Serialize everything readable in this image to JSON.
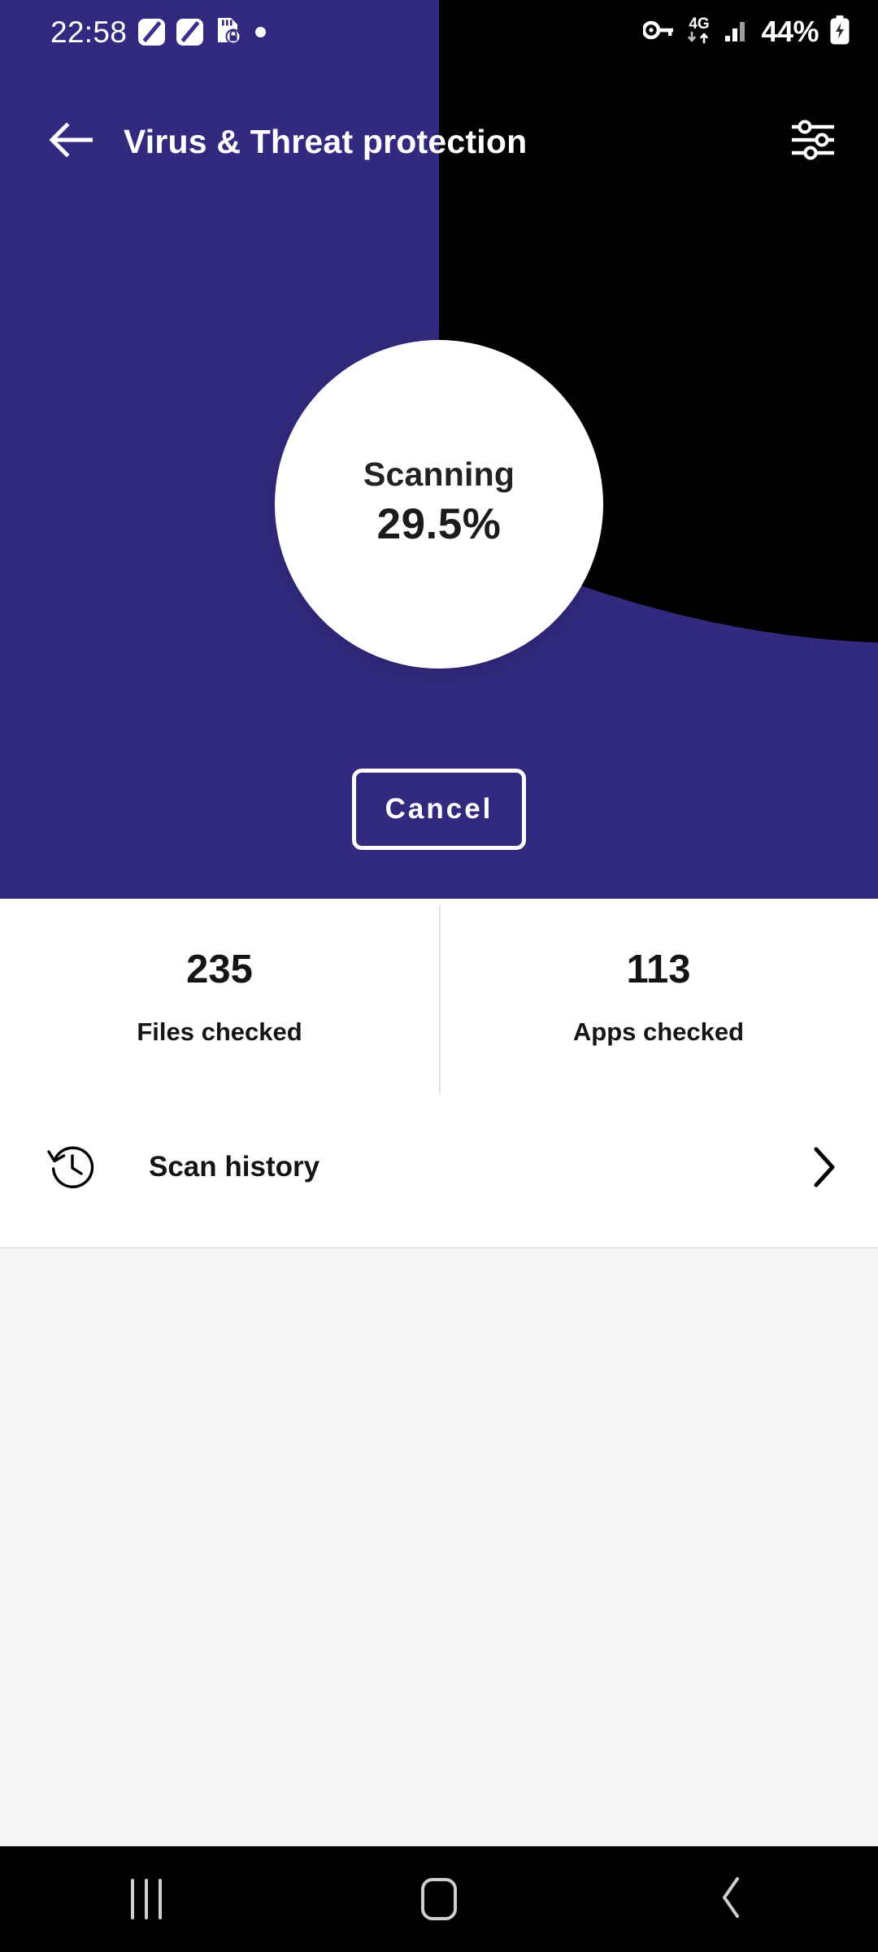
{
  "statusbar": {
    "time": "22:58",
    "battery_percent": "44%",
    "network_label": "4G",
    "icons": [
      "pen-icon",
      "pen-icon",
      "sd-card-lock-icon",
      "dot-icon",
      "vpn-key-icon",
      "mobile-data-4g-icon",
      "signal-bars-icon",
      "battery-charging-icon"
    ]
  },
  "appbar": {
    "title": "Virus & Threat protection",
    "back_icon": "arrow-left-icon",
    "settings_icon": "sliders-icon"
  },
  "scan": {
    "status_label": "Scanning",
    "progress_text": "29.5%",
    "progress_value": 29.5,
    "cancel_label": "Cancel"
  },
  "stats": [
    {
      "value": "235",
      "label": "Files checked"
    },
    {
      "value": "113",
      "label": "Apps checked"
    }
  ],
  "history": {
    "label": "Scan history",
    "icon": "history-clock-icon",
    "chevron": "chevron-right-icon"
  },
  "navbar": {
    "recents_label": "Recents",
    "home_label": "Home",
    "back_label": "Back"
  },
  "colors": {
    "brand_purple": "#332a80",
    "black": "#000000",
    "card_white": "#ffffff",
    "page_bg": "#f5f5f5",
    "divider": "#e3e3e6",
    "nav_icon": "#cfcfcf"
  }
}
